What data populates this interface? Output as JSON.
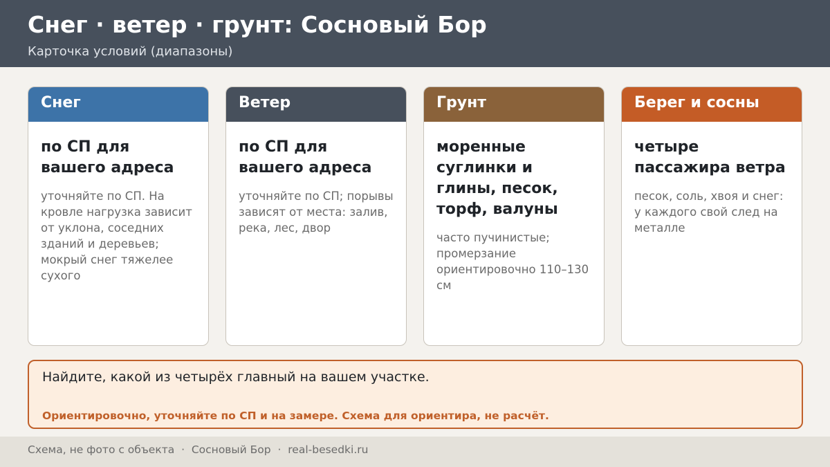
{
  "header": {
    "title": "Снег · ветер · грунт: Сосновый Бор",
    "subtitle": "Карточка условий (диапазоны)",
    "bg_color": "#47505c"
  },
  "cards": [
    {
      "title": "Снег",
      "color": "#3d73a8",
      "main": "по СП для вашего адреса",
      "note": "уточняйте по СП. На кровле нагрузка зависит от уклона, соседних зданий и деревьев; мокрый снег тяжелее сухого"
    },
    {
      "title": "Ветер",
      "color": "#47505c",
      "main": "по СП для вашего адреса",
      "note": "уточняйте по СП; порывы зависят от места: залив, река, лес, двор"
    },
    {
      "title": "Грунт",
      "color": "#8a623a",
      "main": "моренные суглинки и глины, песок, торф, валуны",
      "note": "часто пучинистые; промерзание ориентировочно 110–130 см"
    },
    {
      "title": "Берег и сосны",
      "color": "#c45c26",
      "main": "четыре пассажира ветра",
      "note": "песок, соль, хвоя и снег: у каждого свой след на металле"
    }
  ],
  "callout": {
    "main": "Найдите, какой из четырёх главный на вашем участке.",
    "warning": "Ориентировочно, уточняйте по СП и на замере. Схема для ориентира, не расчёт.",
    "accent_color": "#c0602a"
  },
  "footer": {
    "text": "Схема, не фото с объекта  ·  Сосновый Бор  ·  real-besedki.ru"
  }
}
